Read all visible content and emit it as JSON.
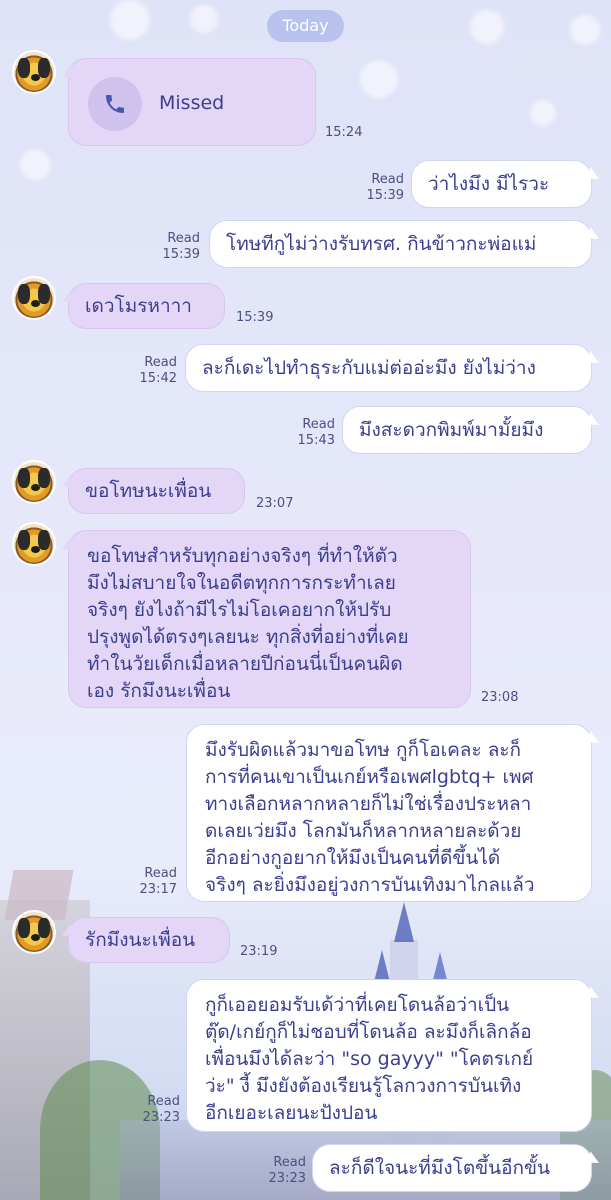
{
  "date_separator": "Today",
  "messages": [
    {
      "id": "m1",
      "dir": "in",
      "kind": "call",
      "call_label": "Missed",
      "time": "15:24"
    },
    {
      "id": "m2",
      "dir": "out",
      "lines": [
        "ว่าไงมึง มีไรวะ"
      ],
      "read": "Read",
      "time": "15:39"
    },
    {
      "id": "m3",
      "dir": "out",
      "lines": [
        "โทษทีกูไม่ว่างรับทรศ. กินข้าวกะพ่อแม่"
      ],
      "read": "Read",
      "time": "15:39"
    },
    {
      "id": "m4",
      "dir": "in",
      "lines": [
        "เดวโมรหาาา"
      ],
      "time": "15:39"
    },
    {
      "id": "m5",
      "dir": "out",
      "lines": [
        "ละก็เดะไปทำธุระกับแม่ต่ออ่ะมึง ยังไม่ว่าง"
      ],
      "read": "Read",
      "time": "15:42"
    },
    {
      "id": "m6",
      "dir": "out",
      "lines": [
        "มึงสะดวกพิมพ์มามั้ยมึง"
      ],
      "read": "Read",
      "time": "15:43"
    },
    {
      "id": "m7",
      "dir": "in",
      "lines": [
        "ขอโทษนะเพื่อน"
      ],
      "time": "23:07"
    },
    {
      "id": "m8",
      "dir": "in",
      "lines": [
        "ขอโทษสำหรับทุกอย่างจริงๆ ที่ทำให้ตัว",
        "มึงไม่สบายใจในอดีตทุกการกระทำเลย",
        "จริงๆ ยังไงถ้ามีไรไม่โอเคอยากให้ปรับ",
        "ปรุงพูดได้ตรงๆเลยนะ ทุกสิ่งที่อย่างที่เคย",
        "ทำในวัยเด็กเมื่อหลายปีก่อนนี่เป็นคนผิด",
        "เอง รักมึงนะเพื่อน"
      ],
      "time": "23:08"
    },
    {
      "id": "m9",
      "dir": "out",
      "lines": [
        "มึงรับผิดแล้วมาขอโทษ กูก็โอเคละ ละก็",
        "การที่คนเขาเป็นเกย์หรือเพศlgbtq+ เพศ",
        "ทางเลือกหลากหลายก็ไม่ใช่เรื่องประหลา",
        "ดเลยเว่ยมึง โลกมันก็หลากหลายละด้วย",
        "อีกอย่างกูอยากให้มึงเป็นคนที่ดีขึ้นได้",
        "จริงๆ ละยิ่งมึงอยู่วงการบันเทิงมาไกลแล้ว"
      ],
      "read": "Read",
      "time": "23:17"
    },
    {
      "id": "m10",
      "dir": "in",
      "lines": [
        "รักมึงนะเพื่อน"
      ],
      "time": "23:19"
    },
    {
      "id": "m11",
      "dir": "out",
      "lines": [
        "กูก็เออยอมรับเด้ว่าที่เคยโดนล้อว่าเป็น",
        "ตุ๊ด/เกย์กูก็ไม่ชอบที่โดนล้อ ละมึงก็เลิกล้อ",
        "เพื่อนมึงได้ละว่า \"so gayyy\" \"โคตรเกย์",
        "ว่ะ\" งี้ มึงยังต้องเรียนรู้โลกวงการบันเทิง",
        "อีกเยอะเลยนะปังปอน"
      ],
      "read": "Read",
      "time": "23:23"
    },
    {
      "id": "m12",
      "dir": "out",
      "lines": [
        "ละก็ดีใจนะที่มึงโตขึ้นอีกขั้น"
      ],
      "read": "Read",
      "time": "23:23"
    }
  ],
  "icons": {
    "call": "phone-icon",
    "avatar": "contact-avatar"
  },
  "colors": {
    "incoming_bubble": "#e4d6f6",
    "outgoing_bubble": "#ffffff",
    "text": "#3b3f8f",
    "date_pill": "#b7c3ee"
  }
}
